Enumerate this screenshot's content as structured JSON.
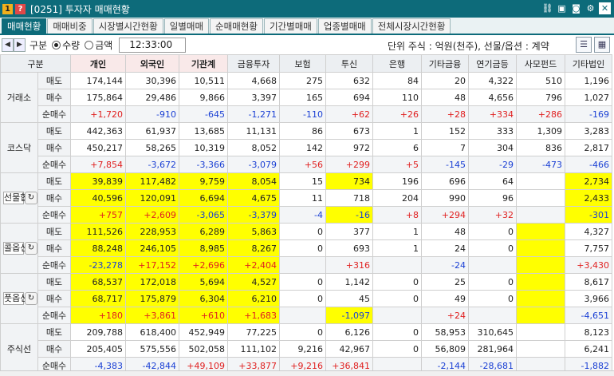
{
  "window": {
    "icon1": "1",
    "icon2": "?",
    "title": "[0251] 투자자 매매현황",
    "buttons": [
      "link-icon",
      "window-icon",
      "camera-icon",
      "gear-icon",
      "close-icon"
    ]
  },
  "tabs": [
    {
      "label": "매매현황",
      "active": true
    },
    {
      "label": "매매비중",
      "active": false
    },
    {
      "label": "시장별시간현황",
      "active": false
    },
    {
      "label": "일별매매",
      "active": false
    },
    {
      "label": "순매매현황",
      "active": false
    },
    {
      "label": "기간별매매",
      "active": false
    },
    {
      "label": "업종별매매",
      "active": false
    },
    {
      "label": "전체시장시간현황",
      "active": false
    }
  ],
  "toolbar": {
    "gubun_label": "구분",
    "radio_qty": "수량",
    "radio_amt": "금액",
    "selected": "수량",
    "time": "12:33:00",
    "unit_text": "단위 주식 : 억원(천주), 선물/옵션 : 계약"
  },
  "colors": {
    "titlebar": "#0d6b7a",
    "highlight": "#ffff00",
    "positive": "#e02020",
    "negative": "#1a3fd4"
  },
  "table": {
    "headers": [
      "구분",
      "개인",
      "외국인",
      "기관계",
      "금융투자",
      "보험",
      "투신",
      "은행",
      "기타금융",
      "연기금등",
      "사모펀드",
      "기타법인"
    ],
    "groups": [
      {
        "name": "거래소",
        "button": false,
        "rows": [
          {
            "label": "매도",
            "values": [
              "174,144",
              "30,396",
              "10,511",
              "4,668",
              "275",
              "632",
              "84",
              "20",
              "4,322",
              "510",
              "1,196"
            ]
          },
          {
            "label": "매수",
            "values": [
              "175,864",
              "29,486",
              "9,866",
              "3,397",
              "165",
              "694",
              "110",
              "48",
              "4,656",
              "796",
              "1,027"
            ]
          },
          {
            "label": "순매수",
            "values": [
              "+1,720",
              "-910",
              "-645",
              "-1,271",
              "-110",
              "+62",
              "+26",
              "+28",
              "+334",
              "+286",
              "-169"
            ]
          }
        ]
      },
      {
        "name": "코스닥",
        "button": false,
        "rows": [
          {
            "label": "매도",
            "values": [
              "442,363",
              "61,937",
              "13,685",
              "11,131",
              "86",
              "673",
              "1",
              "152",
              "333",
              "1,309",
              "3,283"
            ]
          },
          {
            "label": "매수",
            "values": [
              "450,217",
              "58,265",
              "10,319",
              "8,052",
              "142",
              "972",
              "6",
              "7",
              "304",
              "836",
              "2,817"
            ]
          },
          {
            "label": "순매수",
            "values": [
              "+7,854",
              "-3,672",
              "-3,366",
              "-3,079",
              "+56",
              "+299",
              "+5",
              "-145",
              "-29",
              "-473",
              "-466"
            ]
          }
        ]
      },
      {
        "name": "선물합산",
        "button": true,
        "rows": [
          {
            "label": "매도",
            "values": [
              "39,839",
              "117,482",
              "9,759",
              "8,054",
              "15",
              "734",
              "196",
              "696",
              "64",
              "",
              "2,734"
            ]
          },
          {
            "label": "매수",
            "values": [
              "40,596",
              "120,091",
              "6,694",
              "4,675",
              "11",
              "718",
              "204",
              "990",
              "96",
              "",
              "2,433"
            ]
          },
          {
            "label": "순매수",
            "values": [
              "+757",
              "+2,609",
              "-3,065",
              "-3,379",
              "-4",
              "-16",
              "+8",
              "+294",
              "+32",
              "",
              "-301"
            ]
          }
        ]
      },
      {
        "name": "콜옵션",
        "button": true,
        "rows": [
          {
            "label": "매도",
            "values": [
              "111,526",
              "228,953",
              "6,289",
              "5,863",
              "0",
              "377",
              "1",
              "48",
              "0",
              "",
              "4,327"
            ]
          },
          {
            "label": "매수",
            "values": [
              "88,248",
              "246,105",
              "8,985",
              "8,267",
              "0",
              "693",
              "1",
              "24",
              "0",
              "",
              "7,757"
            ]
          },
          {
            "label": "순매수",
            "values": [
              "-23,278",
              "+17,152",
              "+2,696",
              "+2,404",
              "",
              "+316",
              "",
              "-24",
              "",
              "",
              "+3,430"
            ]
          }
        ]
      },
      {
        "name": "풋옵션",
        "button": true,
        "rows": [
          {
            "label": "매도",
            "values": [
              "68,537",
              "172,018",
              "5,694",
              "4,527",
              "0",
              "1,142",
              "0",
              "25",
              "0",
              "",
              "8,617"
            ]
          },
          {
            "label": "매수",
            "values": [
              "68,717",
              "175,879",
              "6,304",
              "6,210",
              "0",
              "45",
              "0",
              "49",
              "0",
              "",
              "3,966"
            ]
          },
          {
            "label": "순매수",
            "values": [
              "+180",
              "+3,861",
              "+610",
              "+1,683",
              "",
              "-1,097",
              "",
              "+24",
              "",
              "",
              "-4,651"
            ]
          }
        ]
      },
      {
        "name": "주식선",
        "button": false,
        "rows": [
          {
            "label": "매도",
            "values": [
              "209,788",
              "618,400",
              "452,949",
              "77,225",
              "0",
              "6,126",
              "0",
              "58,953",
              "310,645",
              "",
              "8,123"
            ]
          },
          {
            "label": "매수",
            "values": [
              "205,405",
              "575,556",
              "502,058",
              "111,102",
              "9,216",
              "42,967",
              "0",
              "56,809",
              "281,964",
              "",
              "6,241"
            ]
          },
          {
            "label": "순매수",
            "values": [
              "-4,383",
              "-42,844",
              "+49,109",
              "+33,877",
              "+9,216",
              "+36,841",
              "",
              "-2,144",
              "-28,681",
              "",
              "-1,882"
            ]
          }
        ]
      }
    ]
  }
}
